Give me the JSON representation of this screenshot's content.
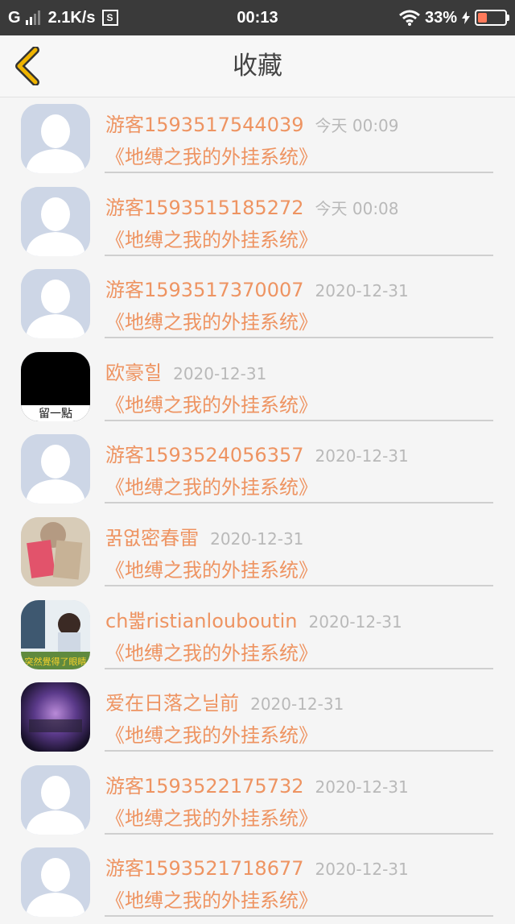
{
  "status_bar": {
    "network": "G",
    "speed": "2.1K/s",
    "s_badge": "S",
    "time": "00:13",
    "battery": "33%",
    "battery_level": 0.33,
    "battery_color": "#ff7a5a"
  },
  "nav": {
    "back_icon": "chevron-left-icon",
    "title": "收藏",
    "accent": "#f0b400"
  },
  "list": [
    {
      "name": "游客1593517544039",
      "time": "今天 00:09",
      "book": "《地缚之我的外挂系统》",
      "avatar": "default"
    },
    {
      "name": "游客1593515185272",
      "time": "今天 00:08",
      "book": "《地缚之我的外挂系统》",
      "avatar": "default"
    },
    {
      "name": "游客1593517370007",
      "time": "2020-12-31",
      "book": "《地缚之我的外挂系统》",
      "avatar": "default"
    },
    {
      "name": "欧豪힐",
      "time": "2020-12-31",
      "book": "《地缚之我的外挂系统》",
      "avatar": "black",
      "avatar_text": "留一點"
    },
    {
      "name": "游客1593524056357",
      "time": "2020-12-31",
      "book": "《地缚之我的外挂系统》",
      "avatar": "default"
    },
    {
      "name": "꿁엾密春雷",
      "time": "2020-12-31",
      "book": "《地缚之我的外挂系统》",
      "avatar": "photo-book"
    },
    {
      "name": "ch뿗ristianlouboutin",
      "time": "2020-12-31",
      "book": "《地缚之我的外挂系统》",
      "avatar": "photo-person",
      "avatar_text": "突然覺得了眼睛"
    },
    {
      "name": "爱在日落之닐前",
      "time": "2020-12-31",
      "book": "《地缚之我的外挂系统》",
      "avatar": "photo-galaxy"
    },
    {
      "name": "游客1593522175732",
      "time": "2020-12-31",
      "book": "《地缚之我的外挂系统》",
      "avatar": "default"
    },
    {
      "name": "游客1593521718677",
      "time": "2020-12-31",
      "book": "《地缚之我的外挂系统》",
      "avatar": "default"
    }
  ]
}
